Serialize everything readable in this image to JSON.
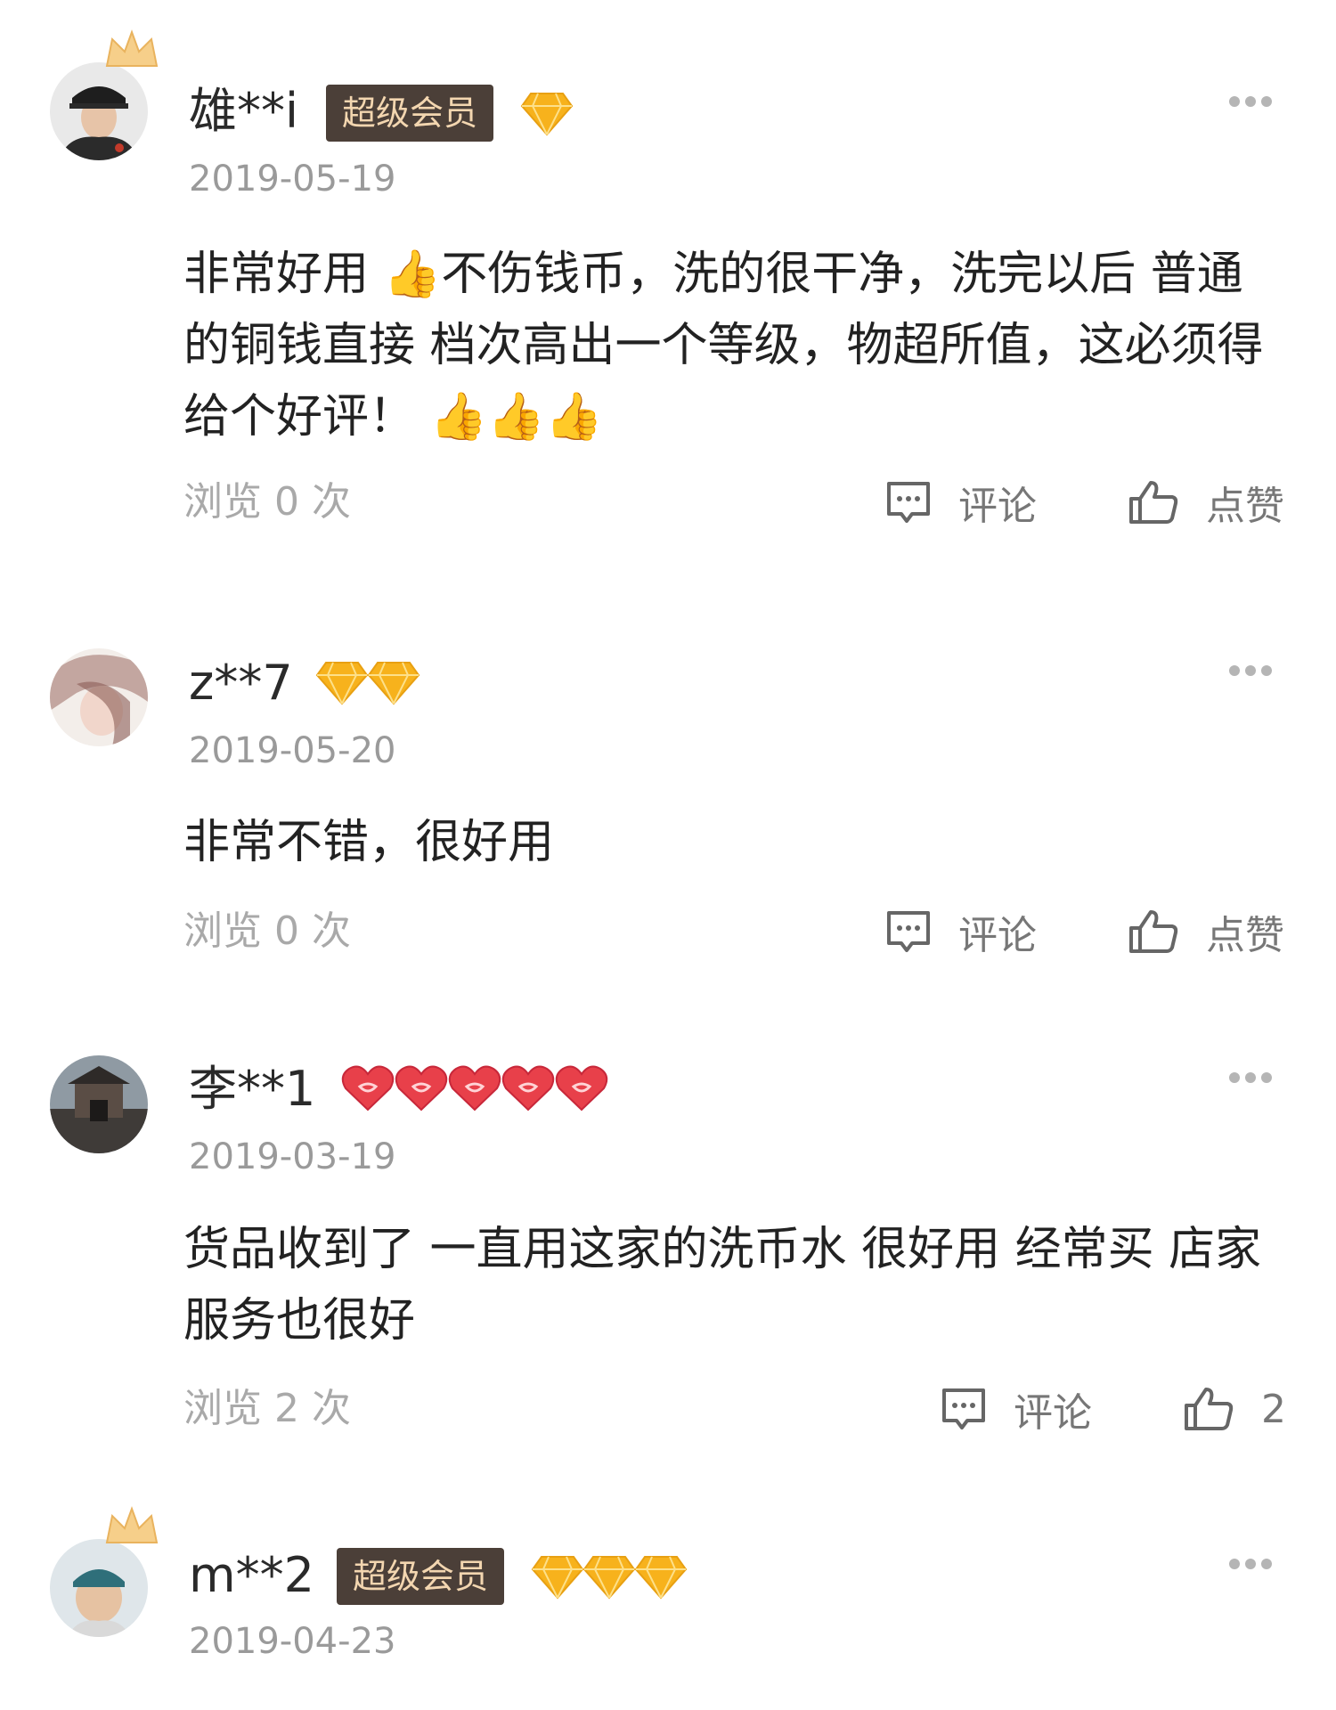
{
  "reviews": [
    {
      "username": "雄**i",
      "vip_label": "超级会员",
      "has_crown": true,
      "badge_type": "diamond",
      "badge_count": 1,
      "date": "2019-05-19",
      "content": "非常好用 👍不伤钱币，洗的很干净，洗完以后 普通的铜钱直接 档次高出一个等级，物超所值，这必须得给个好评！ 👍👍👍",
      "views": "浏览 0 次",
      "comment_label": "评论",
      "like_label": "点赞"
    },
    {
      "username": "z**7",
      "vip_label": "",
      "has_crown": false,
      "badge_type": "diamond",
      "badge_count": 2,
      "date": "2019-05-20",
      "content": "非常不错，很好用",
      "views": "浏览 0 次",
      "comment_label": "评论",
      "like_label": "点赞"
    },
    {
      "username": "李**1",
      "vip_label": "",
      "has_crown": false,
      "badge_type": "heart",
      "badge_count": 5,
      "date": "2019-03-19",
      "content": "货品收到了 一直用这家的洗币水 很好用 经常买 店家服务也很好",
      "views": "浏览 2 次",
      "comment_label": "评论",
      "like_label": "2"
    },
    {
      "username": "m**2",
      "vip_label": "超级会员",
      "has_crown": true,
      "badge_type": "diamond",
      "badge_count": 3,
      "date": "2019-04-23"
    }
  ],
  "colors": {
    "vip_bg": "#4b3f38",
    "vip_text": "#f3d6b0",
    "diamond": "#f7b21c",
    "heart": "#e8404a"
  },
  "icons": {
    "more": "more-dots-icon",
    "comment": "comment-bubble-icon",
    "like": "thumbs-up-outline-icon",
    "crown": "crown-icon"
  }
}
